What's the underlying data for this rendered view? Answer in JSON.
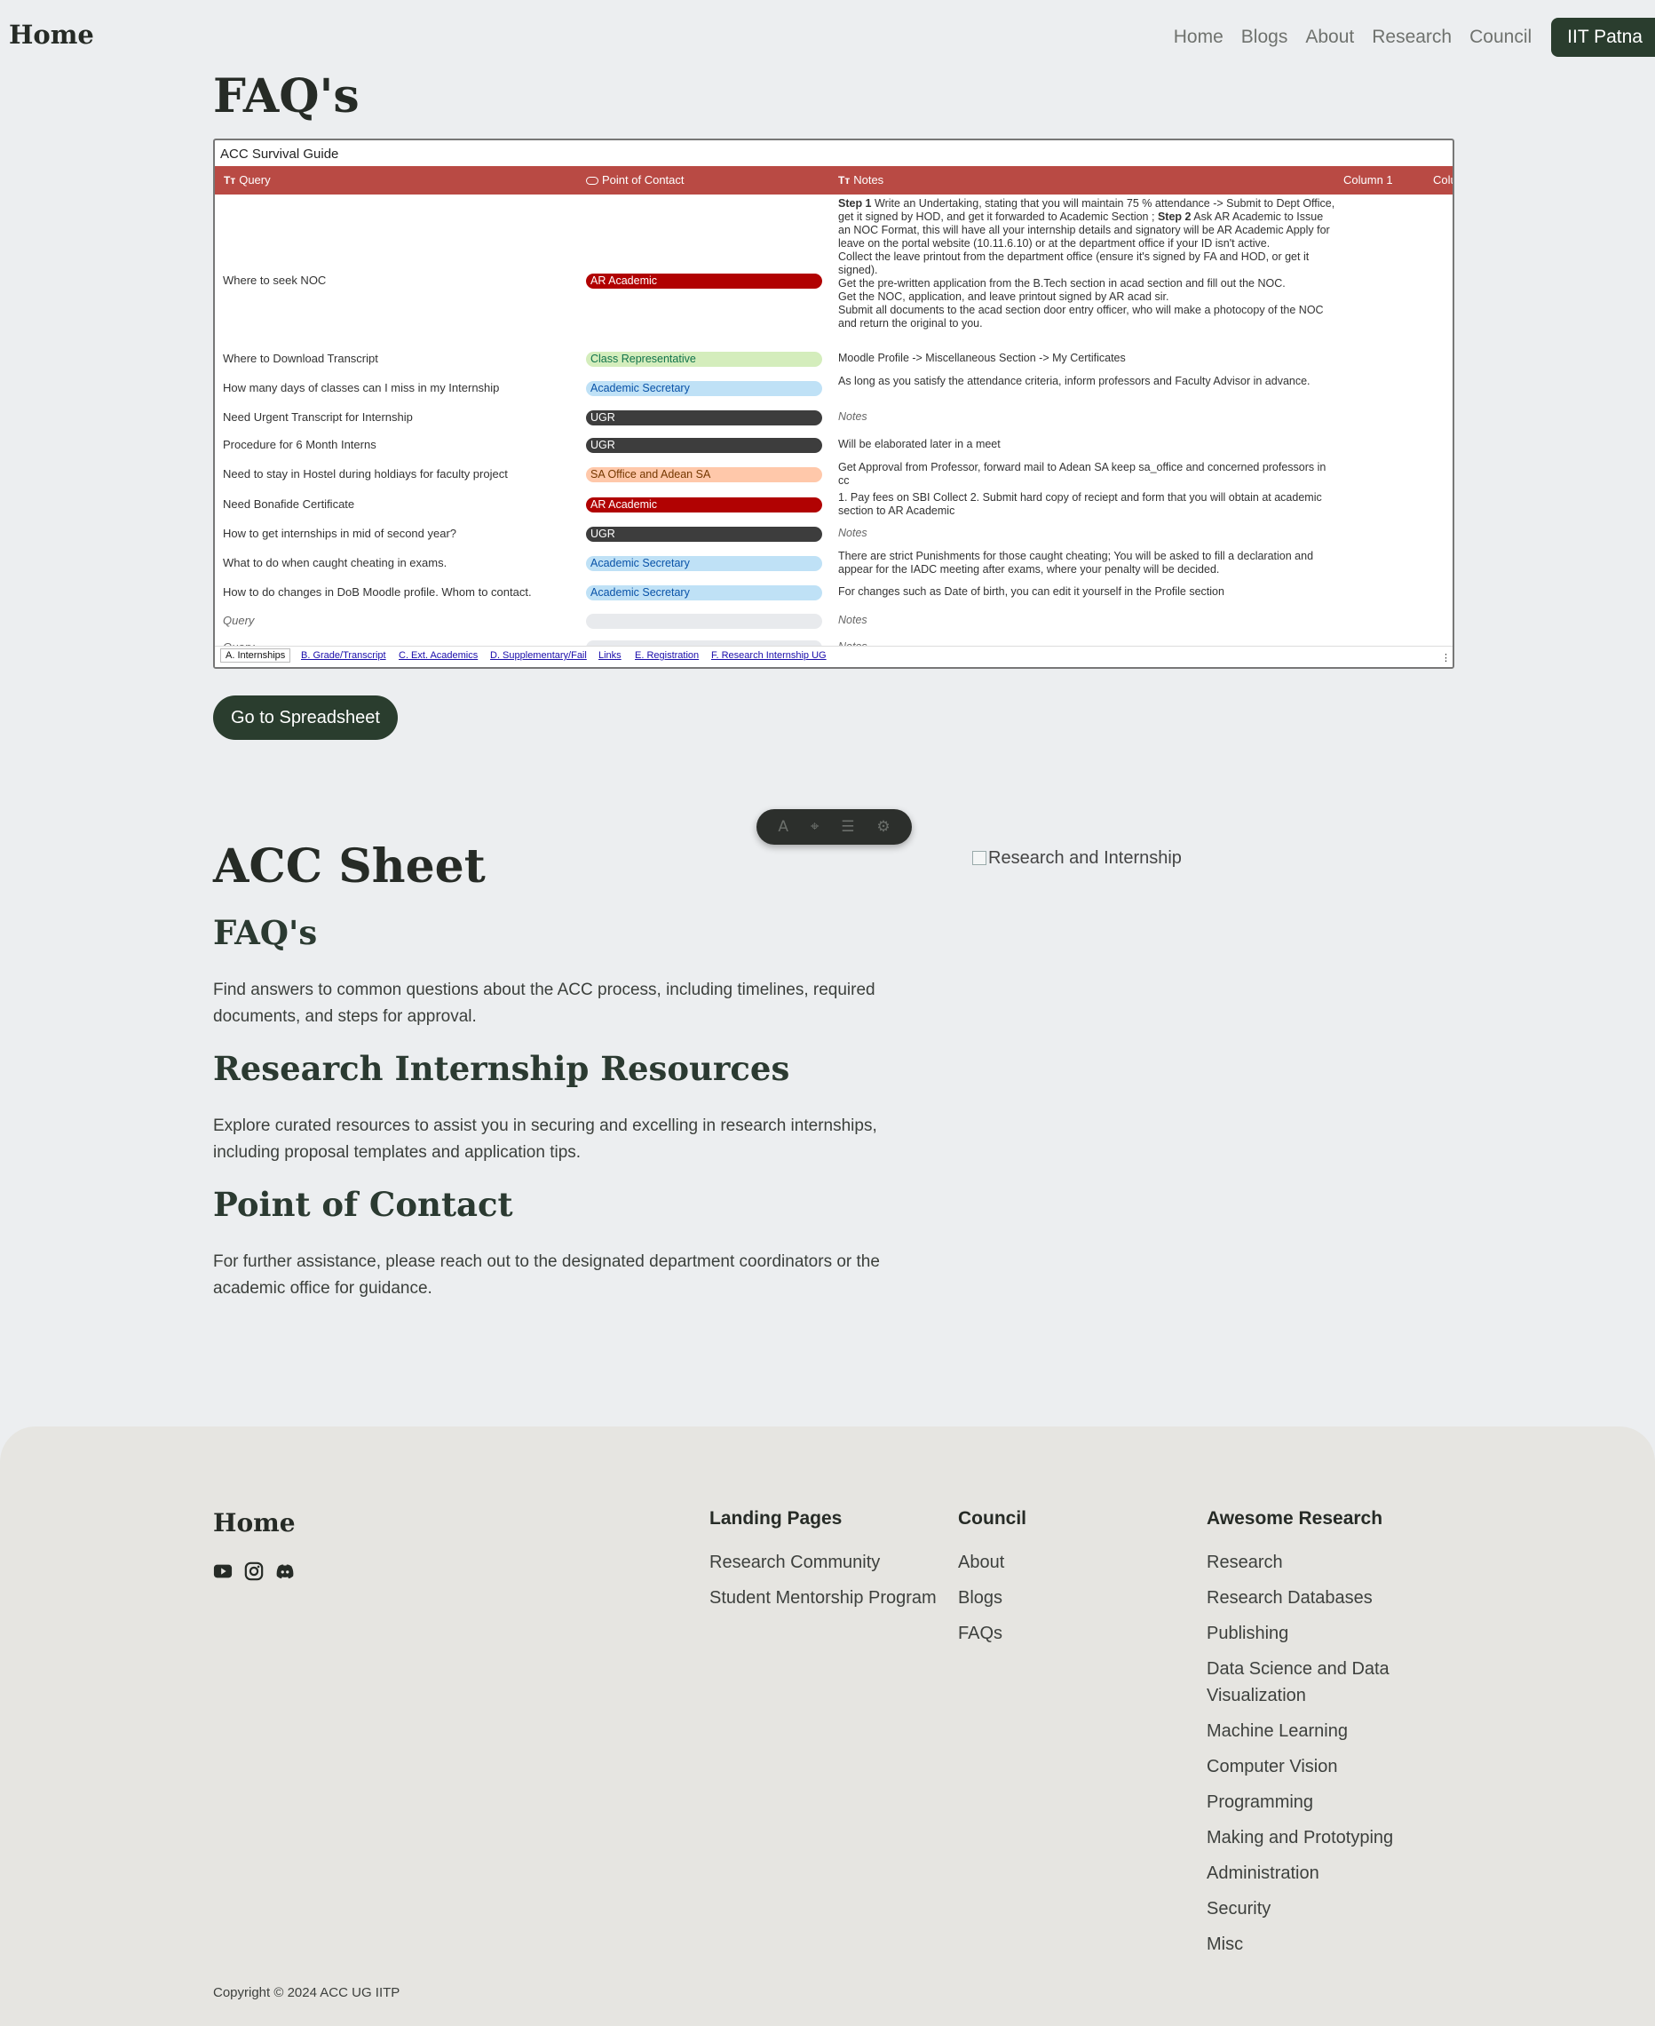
{
  "nav": {
    "brand": "Home",
    "links": [
      "Home",
      "Blogs",
      "About",
      "Research",
      "Council"
    ],
    "cta": "IIT Patna"
  },
  "faq_heading": "FAQ's",
  "sheet": {
    "title": "ACC Survival Guide",
    "columns": [
      "Query",
      "Point of Contact",
      "Notes",
      "Column 1",
      "Colu"
    ],
    "rows": [
      {
        "query": "Where to seek NOC",
        "contact": "AR Academic",
        "notes_step1_label": "Step 1",
        "notes_a": "Write an Undertaking, stating that you will maintain 75 % attendance -> Submit to Dept Office, get it signed by HOD, and get it forwarded to Academic Section ;",
        "notes_step2_label": "Step 2",
        "notes_b": "Ask AR Academic to Issue an NOC Format, this will have all your internship details and signatory will be AR Academic Apply for leave on the portal website (10.11.6.10) or at the department office if your ID isn't active.",
        "notes_c": "Collect the leave printout from the department office (ensure it's signed by FA and HOD, or get it signed).",
        "notes_d": "Get the pre-written application from the B.Tech section in acad section and fill out the NOC.",
        "notes_e": "Get the NOC, application, and leave printout signed by AR acad sir.",
        "notes_f": "Submit all documents to the acad section door entry officer, who will make a photocopy of the NOC and return the original to you."
      },
      {
        "query": "Where to Download Transcript",
        "contact": "Class Representative",
        "notes": "Moodle Profile -> Miscellaneous Section -> My Certificates"
      },
      {
        "query": "How many days of classes can I miss in my Internship",
        "contact": "Academic Secretary",
        "notes": "As long as you satisfy the attendance criteria, inform professors and Faculty Advisor in advance."
      },
      {
        "query": "Need Urgent Transcript for Internship",
        "contact": "UGR",
        "notes": "Notes"
      },
      {
        "query": "Procedure for 6 Month Interns",
        "contact": "UGR",
        "notes": "Will be elaborated later in a meet"
      },
      {
        "query": "Need to stay in Hostel during holdiays for faculty project",
        "contact": "SA Office and Adean SA",
        "notes": "Get Approval from Professor, forward mail to Adean SA keep sa_office and concerned professors in cc"
      },
      {
        "query": "Need Bonafide Certificate",
        "contact": "AR Academic",
        "notes": "1. Pay fees on SBI Collect 2. Submit hard copy of reciept and form that you will obtain at academic section to AR Academic"
      },
      {
        "query": "How to get internships in mid of second year?",
        "contact": "UGR",
        "notes": "Notes"
      },
      {
        "query": "What to do when caught cheating in exams.",
        "contact": "Academic Secretary",
        "notes": "There are strict Punishments for those caught cheating; You will be asked to fill a declaration and appear for the IADC meeting after exams, where your penalty will be decided."
      },
      {
        "query": "How to do changes in DoB Moodle profile. Whom to contact.",
        "contact": "Academic Secretary",
        "notes": "For changes such as Date of birth, you can edit it yourself in the Profile section"
      },
      {
        "query": "Query",
        "contact": "",
        "notes": "Notes"
      },
      {
        "query": "Query",
        "contact": "",
        "notes": "Notes"
      }
    ],
    "tabs": [
      "A. Internships",
      "B. Grade/Transcript",
      "C. Ext. Academics",
      "D. Supplementary/Fail",
      "Links",
      "E. Registration",
      "F. Research Internship UG"
    ]
  },
  "go_button": "Go to Spreadsheet",
  "toolbar_icons": [
    "text-icon",
    "cursor-icon",
    "search-list-icon",
    "settings-icon"
  ],
  "content": {
    "title": "ACC Sheet",
    "faq_h": "FAQ's",
    "faq_p": "Find answers to common questions about the ACC process, including timelines, required documents, and steps for approval.",
    "ri_h": "Research Internship Resources",
    "ri_p": "Explore curated resources to assist you in securing and excelling in research internships, including proposal templates and application tips.",
    "poc_h": "Point of Contact",
    "poc_p": "For further assistance, please reach out to the designated department coordinators or the academic office for guidance.",
    "image_alt": "Research and Internship"
  },
  "footer": {
    "brand": "Home",
    "socials": [
      "youtube-icon",
      "instagram-icon",
      "discord-icon"
    ],
    "landing_title": "Landing Pages",
    "landing": [
      "Research Community",
      "Student Mentorship Program"
    ],
    "council_title": "Council",
    "council": [
      "About",
      "Blogs",
      "FAQs"
    ],
    "research_title": "Awesome Research",
    "research": [
      "Research",
      "Research Databases",
      "Publishing",
      "Data Science and Data Visualization",
      "Machine Learning",
      "Computer Vision",
      "Programming",
      "Making and Prototyping",
      "Administration",
      "Security",
      "Misc"
    ],
    "copyright": "Copyright © 2024 ACC UG IITP"
  }
}
